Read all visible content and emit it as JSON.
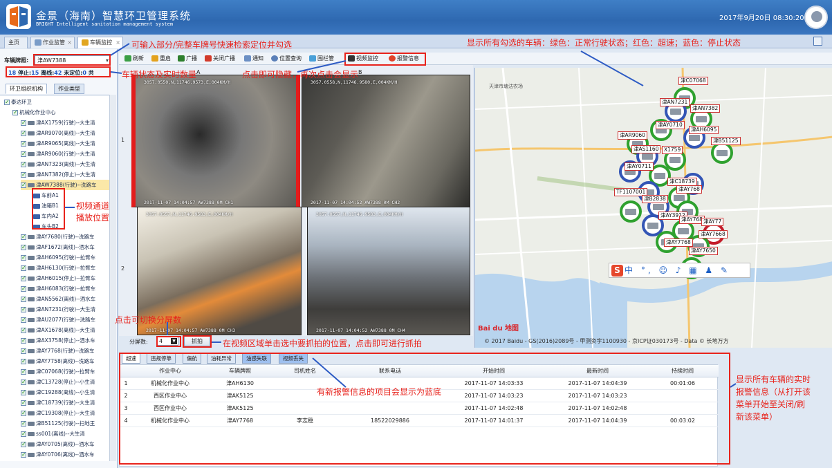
{
  "app": {
    "title": "金景（海南）智慧环卫管理系统",
    "subtitle": "BRIGHT Intelligent sanitation management system",
    "datetime": "2017年9月20日 08:30:20"
  },
  "tabs": [
    {
      "label": "主页"
    },
    {
      "label": "作业监管"
    },
    {
      "label": "车辆监控"
    }
  ],
  "search": {
    "label": "车辆牌照:",
    "value": "津AW7388"
  },
  "counts": {
    "total": "18",
    "stop_label": "停止:",
    "stop": "15",
    "offline_label": "离线:",
    "offline": "42",
    "unknown_label": "未定位:",
    "unknown": "0",
    "suffix": "共"
  },
  "left_tabs": [
    "环卫组织机构",
    "作业类型"
  ],
  "tree": [
    {
      "text": "泰达环卫"
    },
    {
      "text": "机械化作业中心"
    },
    {
      "text": "津AX1759(行驶)--大生清"
    },
    {
      "text": "津AR9070(离线)--大生清"
    },
    {
      "text": "津AR9065(离线)--大生清"
    },
    {
      "text": "津AR9060(行驶)--大生清"
    },
    {
      "text": "津AN7323(离线)--大生清"
    },
    {
      "text": "津AN7382(停止)--大生清"
    },
    {
      "text": "津AW7388(行驶)--洗路车"
    },
    {
      "text": "车前A1"
    },
    {
      "text": "油箱B1"
    },
    {
      "text": "车内A2"
    },
    {
      "text": "车头B2"
    },
    {
      "text": "津AY7680(行驶)--洗路车"
    },
    {
      "text": "津AF1672(离线)--洒水车"
    },
    {
      "text": "津AH6095(行驶)--拉臂车"
    },
    {
      "text": "津AH6130(行驶)--拉臂车"
    },
    {
      "text": "津AH6015(停止)--拉臂车"
    },
    {
      "text": "津AH6083(行驶)--拉臂车"
    },
    {
      "text": "津AN5562(离线)--洒水车"
    },
    {
      "text": "津AN7231(行驶)--大生清"
    },
    {
      "text": "津AU2077(行驶)--洗路车"
    },
    {
      "text": "津AX1678(离线)--大生清"
    },
    {
      "text": "津AX3758(停止)--洒水车"
    },
    {
      "text": "津AY7768(行驶)--洗路车"
    },
    {
      "text": "津AY7758(离线)--洗路车"
    },
    {
      "text": "津C07068(行驶)--拉臂车"
    },
    {
      "text": "津C13728(停止)--小生清"
    },
    {
      "text": "津C19288(离线)--小生清"
    },
    {
      "text": "津C18739(行驶)--大生清"
    },
    {
      "text": "津C19308(停止)--大生清"
    },
    {
      "text": "津B51125(行驶)--扫地王"
    },
    {
      "text": "ss001(离线)--大生清"
    },
    {
      "text": "津AY0705(离线)--洒水车"
    },
    {
      "text": "津AY0706(离线)--洒水车"
    }
  ],
  "toolbar": {
    "items": [
      "刷新",
      "重启",
      "广播",
      "关闭广播",
      "通知",
      "位置查询",
      "围栏管",
      "视频监控",
      "报警信息"
    ]
  },
  "video": {
    "row1": "1",
    "row2": "2",
    "osd": [
      "3057.0550,N,11746.9573,E,004KM/H",
      "3057.0558,N,11746.9580,E,004KM/H",
      "2017-11-07 14:04:57",
      "AW7388 0M CH1",
      "2017-11-07 14:04:52",
      "AW7388 0M CH2"
    ],
    "osd_b1": "3057.0557,N,11746.9583,E,004KM/H",
    "osd_b2": "3057.0557,N,11746.9583,E,004KM/H",
    "ts_b1": "2017-11-07 14:04:57   AW7388 0M CH3",
    "ts_b2": "2017-11-07 14:04:52   AW7388 0M CH4"
  },
  "split": {
    "label": "分屏数:",
    "value": "4"
  },
  "capture": {
    "label": "抓拍"
  },
  "map": {
    "place": "天津市塘沽农场",
    "copyright": "© 2017 Baidu - GS(2016)2089号 - 甲测资字1100930 - 京ICP证030173号 - Data © 长地万方",
    "baidu": "Bai du 地图",
    "labels": [
      "津C07068",
      "津AN7231",
      "津AN7382",
      "津AY0710",
      "津AH6095",
      "津AR9060",
      "津B51125",
      "津AS1160",
      "X1759",
      "津AY0711",
      "津C18739",
      "津AY768",
      "TF1107001",
      "津B2838",
      "津AY3912",
      "津AY768",
      "津AY77",
      "津AY7768",
      "津AY7650",
      "津AY7668"
    ]
  },
  "ime": {
    "text": "中 °,"
  },
  "alarm_tabs": [
    "超速",
    "违规停靠",
    "偏航",
    "油耗异常",
    "油感失联",
    "视频丢失"
  ],
  "alarm_table": {
    "headers": [
      "作业中心",
      "车辆牌照",
      "司机姓名",
      "联系电话",
      "开始时间",
      "最新时间",
      "持续时间"
    ],
    "rows": [
      {
        "no": "1",
        "center": "机械化作业中心",
        "plate": "津AH6130",
        "driver": "",
        "phone": "",
        "start": "2017-11-07 14:03:33",
        "latest": "2017-11-07 14:04:39",
        "duration": "00:01:06"
      },
      {
        "no": "2",
        "center": "西区作业中心",
        "plate": "津AK5125",
        "driver": "",
        "phone": "",
        "start": "2017-11-07 14:03:23",
        "latest": "2017-11-07 14:03:23",
        "duration": ""
      },
      {
        "no": "3",
        "center": "西区作业中心",
        "plate": "津AK5125",
        "driver": "",
        "phone": "",
        "start": "2017-11-07 14:02:48",
        "latest": "2017-11-07 14:02:48",
        "duration": ""
      },
      {
        "no": "4",
        "center": "机械化作业中心",
        "plate": "津AY7768",
        "driver": "李志稳",
        "phone": "18522029886",
        "start": "2017-11-07 14:01:37",
        "latest": "2017-11-07 14:04:39",
        "duration": "00:03:02"
      }
    ]
  },
  "annotations": {
    "search": "可输入部分/完整车牌号快速检索定位并勾选",
    "status": "车辆状态及实时数量",
    "status_mark": "A",
    "click_hide": "点击即可隐藏，再次点击会显示",
    "click_mark": "B",
    "map": "显示所有勾选的车辆：绿色：正常行驶状态；红色：超速；蓝色：停止状态",
    "channel": "视频通道\n播放位置",
    "channel1": "视频通道",
    "channel2": "播放位置",
    "split": "点击可切换分屏数",
    "capture": "在视频区域单击选中要抓拍的位置，点击即可进行抓拍",
    "new_alarm": "有新报警信息的项目会显示为蓝底",
    "realtime1": "显示所有车辆的实时",
    "realtime2": "报警信息（从打开该",
    "realtime3": "菜单开始至关闭/刷",
    "realtime4": "新该菜单）"
  },
  "colors": {
    "header": "#2e68b0",
    "annotation": "#e8231c",
    "moving": "#2fa12f",
    "stopped": "#3355b5",
    "speeding": "#c41c2a"
  }
}
